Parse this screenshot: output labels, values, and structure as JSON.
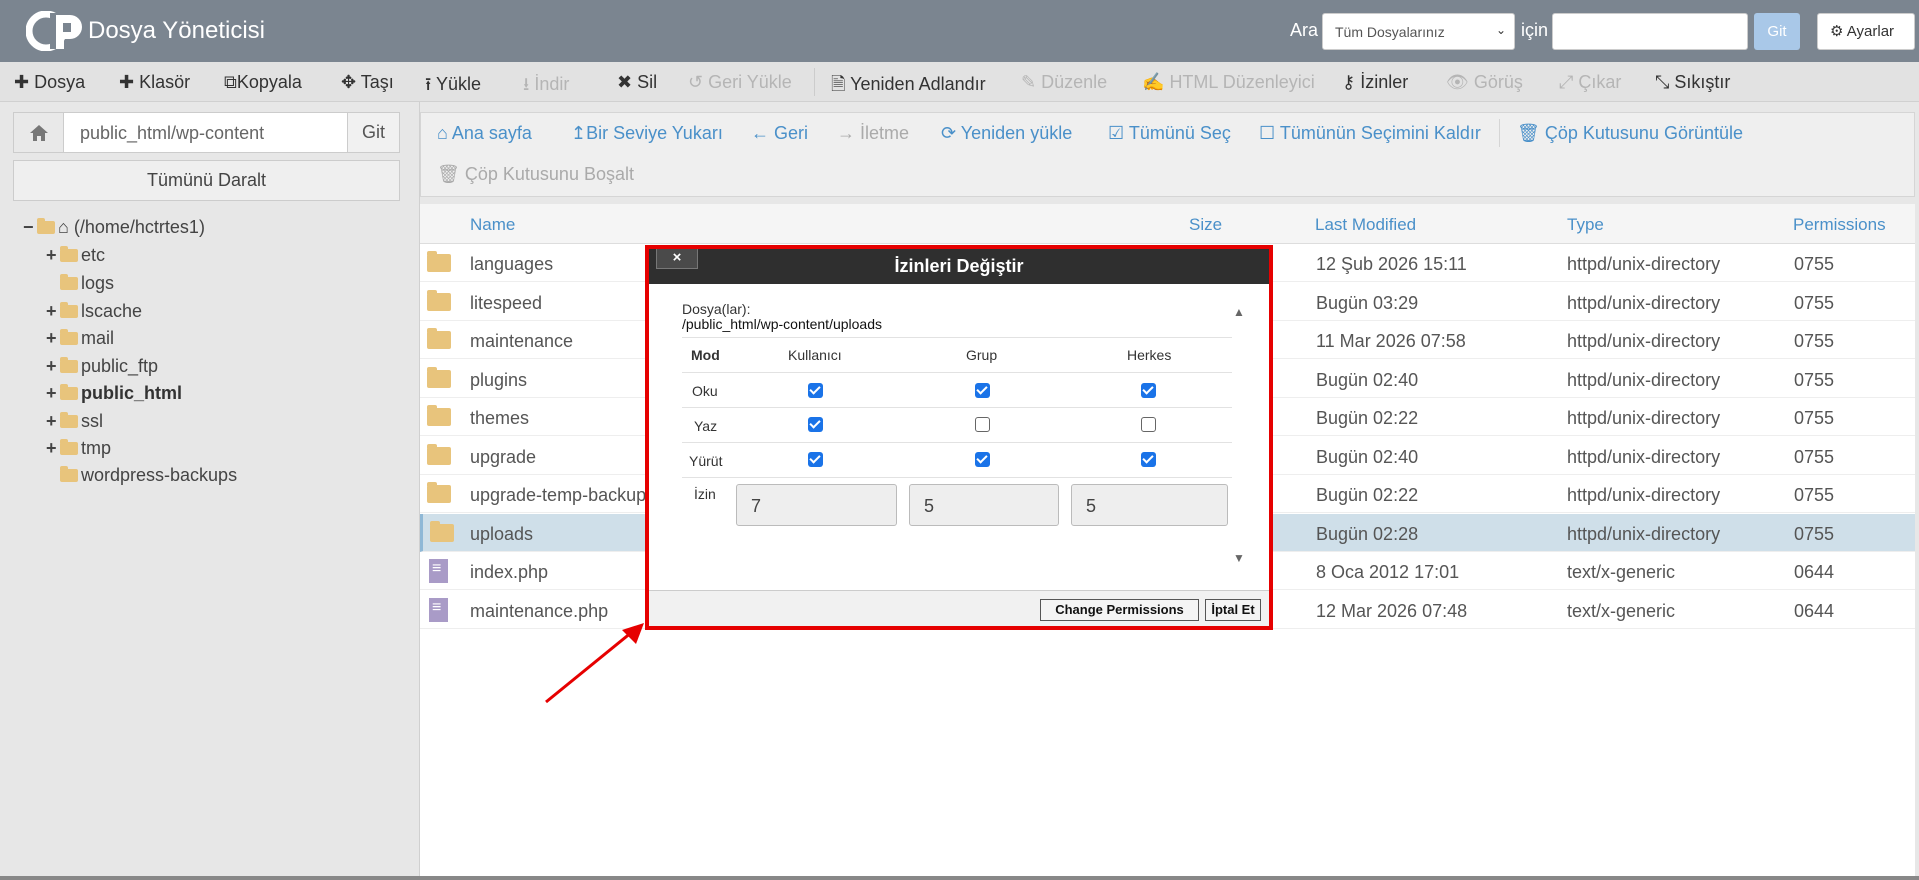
{
  "header": {
    "app_title": "Dosya Yöneticisi",
    "search_label": "Ara",
    "search_scope": "Tüm Dosyalarınız",
    "for_label": "için",
    "search_value": "",
    "go_label": "Git",
    "settings_label": "Ayarlar"
  },
  "toolbar": {
    "items": [
      {
        "label": "Dosya",
        "icon": "plus-icon",
        "enabled": true
      },
      {
        "label": "Klasör",
        "icon": "plus-icon",
        "enabled": true
      },
      {
        "label": "Kopyala",
        "icon": "copy-icon",
        "enabled": true
      },
      {
        "label": "Taşı",
        "icon": "move-icon",
        "enabled": true
      },
      {
        "label": "Yükle",
        "icon": "upload-icon",
        "enabled": true
      },
      {
        "label": "İndir",
        "icon": "download-icon",
        "enabled": false
      },
      {
        "label": "Sil",
        "icon": "x-icon",
        "enabled": true
      },
      {
        "label": "Geri Yükle",
        "icon": "undo-icon",
        "enabled": false
      },
      {
        "label": "Yeniden Adlandır",
        "icon": "file-icon",
        "enabled": true
      },
      {
        "label": "Düzenle",
        "icon": "pencil-icon",
        "enabled": false
      },
      {
        "label": "HTML Düzenleyici",
        "icon": "edit-icon",
        "enabled": false
      },
      {
        "label": "İzinler",
        "icon": "key-icon",
        "enabled": true
      },
      {
        "label": "Görüş",
        "icon": "eye-icon",
        "enabled": false
      },
      {
        "label": "Çıkar",
        "icon": "expand-icon",
        "enabled": false
      },
      {
        "label": "Sıkıştır",
        "icon": "compress-icon",
        "enabled": true
      }
    ]
  },
  "left": {
    "path_value": "public_html/wp-content",
    "go_label": "Git",
    "collapse_label": "Tümünü Daralt",
    "tree": [
      {
        "label": "(/home/hctrtes1)",
        "pm": "−",
        "home": true
      },
      {
        "label": "etc",
        "pm": "+"
      },
      {
        "label": "logs",
        "pm": ""
      },
      {
        "label": "lscache",
        "pm": "+"
      },
      {
        "label": "mail",
        "pm": "+"
      },
      {
        "label": "public_ftp",
        "pm": "+"
      },
      {
        "label": "public_html",
        "pm": "+",
        "bold": true
      },
      {
        "label": "ssl",
        "pm": "+"
      },
      {
        "label": "tmp",
        "pm": "+"
      },
      {
        "label": "wordpress-backups",
        "pm": ""
      }
    ]
  },
  "nav": {
    "home": "Ana sayfa",
    "up": "Bir Seviye Yukarı",
    "back": "Geri",
    "forward": "İletme",
    "reload": "Yeniden yükle",
    "select_all": "Tümünü Seç",
    "deselect_all": "Tümünün Seçimini Kaldır",
    "view_trash": "Çöp Kutusunu Görüntüle",
    "empty_trash": "Çöp Kutusunu Boşalt"
  },
  "table": {
    "headers": {
      "name": "Name",
      "size": "Size",
      "modified": "Last Modified",
      "type": "Type",
      "perms": "Permissions"
    },
    "rows": [
      {
        "name": "languages",
        "modified": "12 Şub 2026 15:11",
        "type": "httpd/unix-directory",
        "perms": "0755",
        "kind": "folder"
      },
      {
        "name": "litespeed",
        "modified": "Bugün 03:29",
        "type": "httpd/unix-directory",
        "perms": "0755",
        "kind": "folder"
      },
      {
        "name": "maintenance",
        "modified": "11 Mar 2026 07:58",
        "type": "httpd/unix-directory",
        "perms": "0755",
        "kind": "folder"
      },
      {
        "name": "plugins",
        "modified": "Bugün 02:40",
        "type": "httpd/unix-directory",
        "perms": "0755",
        "kind": "folder"
      },
      {
        "name": "themes",
        "modified": "Bugün 02:22",
        "type": "httpd/unix-directory",
        "perms": "0755",
        "kind": "folder"
      },
      {
        "name": "upgrade",
        "modified": "Bugün 02:40",
        "type": "httpd/unix-directory",
        "perms": "0755",
        "kind": "folder"
      },
      {
        "name": "upgrade-temp-backup",
        "modified": "Bugün 02:22",
        "type": "httpd/unix-directory",
        "perms": "0755",
        "kind": "folder"
      },
      {
        "name": "uploads",
        "modified": "Bugün 02:28",
        "type": "httpd/unix-directory",
        "perms": "0755",
        "kind": "folder",
        "selected": true
      },
      {
        "name": "index.php",
        "modified": "8 Oca 2012 17:01",
        "type": "text/x-generic",
        "perms": "0644",
        "kind": "file"
      },
      {
        "name": "maintenance.php",
        "modified": "12 Mar 2026 07:48",
        "type": "text/x-generic",
        "perms": "0644",
        "kind": "file"
      }
    ]
  },
  "dialog": {
    "title": "İzinleri Değiştir",
    "close": "×",
    "files_label": "Dosya(lar):",
    "files_path": "/public_html/wp-content/uploads",
    "col_mode": "Mod",
    "col_user": "Kullanıcı",
    "col_group": "Grup",
    "col_world": "Herkes",
    "rows": [
      {
        "label": "Oku",
        "user": true,
        "group": true,
        "world": true
      },
      {
        "label": "Yaz",
        "user": true,
        "group": false,
        "world": false
      },
      {
        "label": "Yürüt",
        "user": true,
        "group": true,
        "world": true
      }
    ],
    "perm_label": "İzin",
    "perm_user": "7",
    "perm_group": "5",
    "perm_world": "5",
    "change_btn": "Change Permissions",
    "cancel_btn": "İptal Et"
  },
  "colors": {
    "accent": "#4a90c9",
    "highlight": "#e60000",
    "header_bg": "#7b8590"
  }
}
